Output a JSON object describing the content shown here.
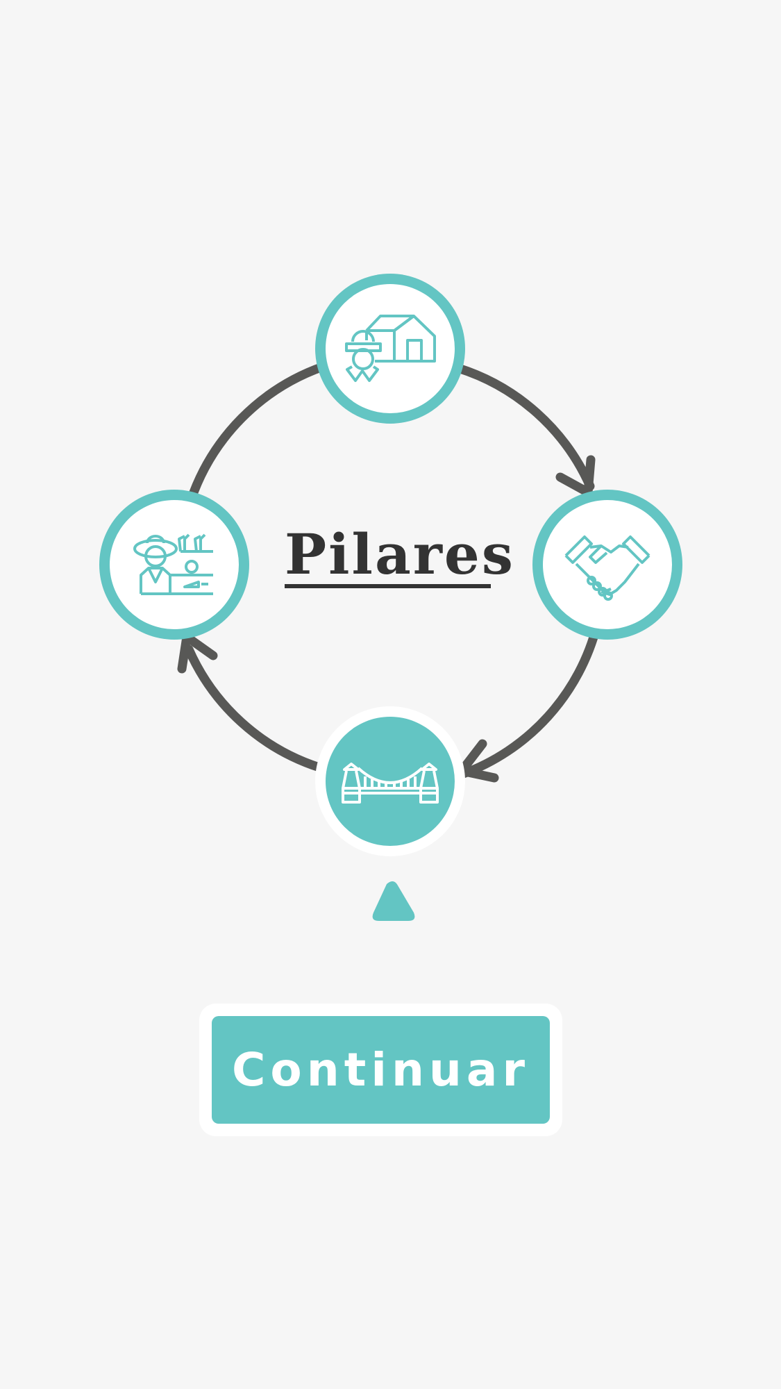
{
  "title": "Pilares",
  "continue_label": "Continuar",
  "colors": {
    "accent": "#63c5c3",
    "arrow": "#585856",
    "background": "#f6f6f6",
    "title": "#333333"
  },
  "pillars": [
    {
      "icon": "house-engineer-icon",
      "state": "normal"
    },
    {
      "icon": "handshake-icon",
      "state": "normal"
    },
    {
      "icon": "bridge-icon",
      "state": "selected"
    },
    {
      "icon": "farmer-market-icon",
      "state": "normal"
    }
  ],
  "pointer_icon": "up-triangle-icon"
}
